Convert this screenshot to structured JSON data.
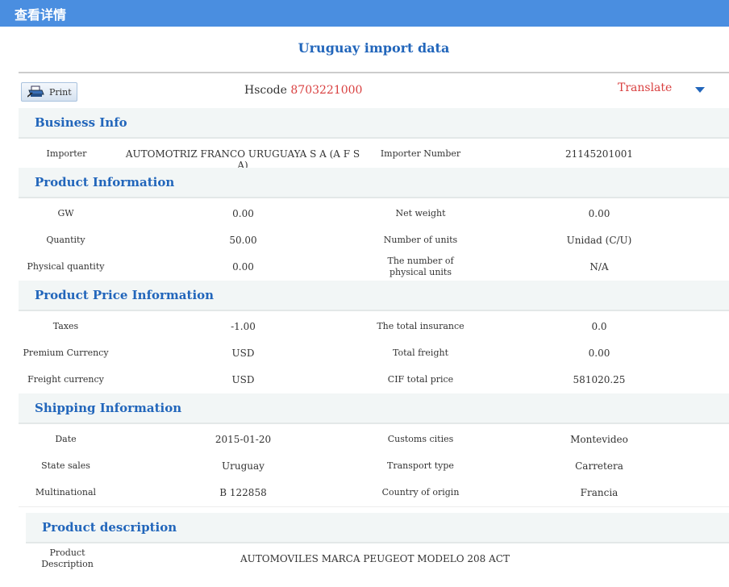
{
  "window": {
    "title": "查看详情"
  },
  "page": {
    "title": "Uruguay import data"
  },
  "toolbar": {
    "print_label": "Print",
    "hscode_label": "Hscode",
    "hscode_value": "8703221000",
    "translate_label": "Translate"
  },
  "sections": {
    "business": {
      "title": "Business Info",
      "importer_label": "Importer",
      "importer_value": "AUTOMOTRIZ FRANCO URUGUAYA S A (A F S A)",
      "importer_number_label": "Importer Number",
      "importer_number_value": "21145201001"
    },
    "product": {
      "title": "Product Information",
      "gw_label": "GW",
      "gw_value": "0.00",
      "net_weight_label": "Net weight",
      "net_weight_value": "0.00",
      "quantity_label": "Quantity",
      "quantity_value": "50.00",
      "units_label": "Number of units",
      "units_value": "Unidad (C/U)",
      "physical_quantity_label": "Physical quantity",
      "physical_quantity_value": "0.00",
      "physical_units_label_1": "The number of",
      "physical_units_label_2": "physical units",
      "physical_units_value": "N/A"
    },
    "price": {
      "title": "Product Price Information",
      "taxes_label": "Taxes",
      "taxes_value": "-1.00",
      "insurance_label": "The total insurance",
      "insurance_value": "0.0",
      "premium_currency_label": "Premium Currency",
      "premium_currency_value": "USD",
      "total_freight_label": "Total freight",
      "total_freight_value": "0.00",
      "freight_currency_label": "Freight currency",
      "freight_currency_value": "USD",
      "cif_label": "CIF total price",
      "cif_value": "581020.25"
    },
    "shipping": {
      "title": "Shipping Information",
      "date_label": "Date",
      "date_value": "2015-01-20",
      "customs_label": "Customs cities",
      "customs_value": "Montevideo",
      "state_label": "State sales",
      "state_value": "Uruguay",
      "transport_label": "Transport type",
      "transport_value": "Carretera",
      "multinational_label": "Multinational",
      "multinational_value": "B 122858",
      "origin_label": "Country of origin",
      "origin_value": "Francia"
    },
    "description": {
      "title": "Product description",
      "label_1": "Product",
      "label_2": "Description",
      "value": "AUTOMOVILES MARCA PEUGEOT MODELO 208 ACT"
    }
  },
  "colors": {
    "header_bg": "#4a8ee0",
    "heading": "#2266bb",
    "accent_red": "#d94040",
    "section_bg": "#f2f6f6"
  },
  "icons": {
    "print": "printer-icon",
    "translate_toggle": "caret-down-icon"
  }
}
